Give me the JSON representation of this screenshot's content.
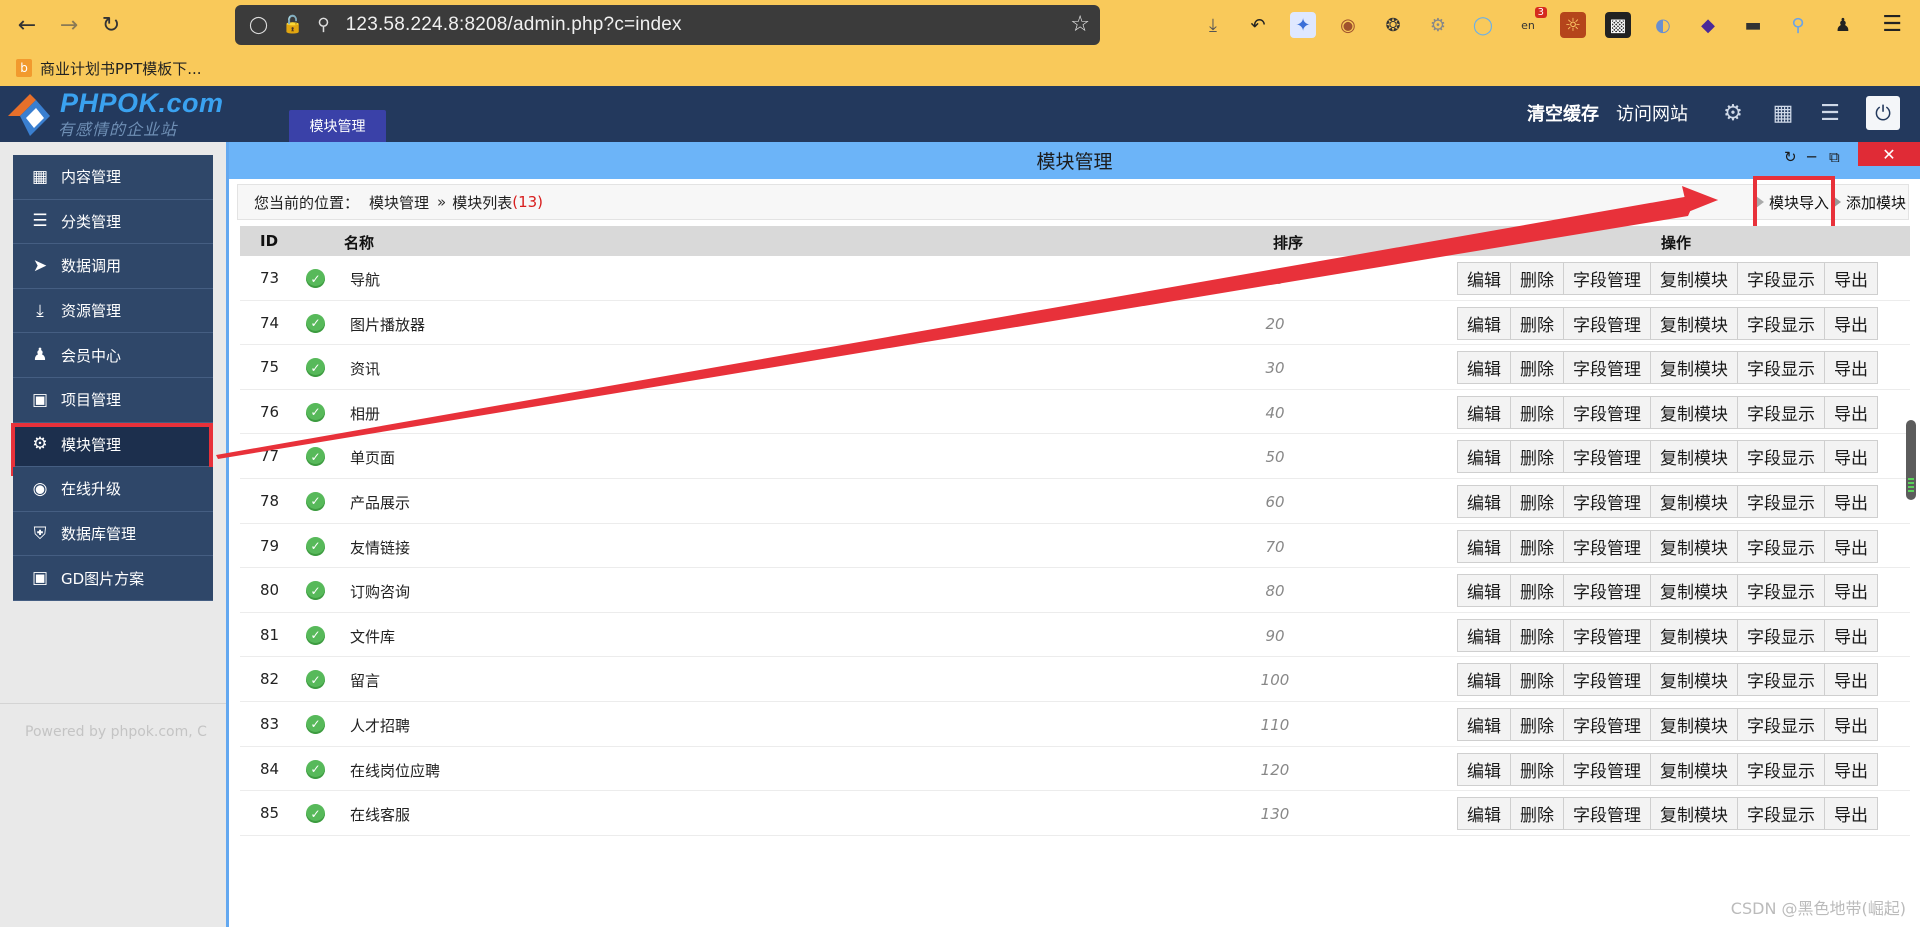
{
  "browser": {
    "url": "123.58.224.8:8208/admin.php?c=index",
    "bookmark": "商业计划书PPT模板下...",
    "ext_badge": "3",
    "ext_sub": "en"
  },
  "header": {
    "logo_text": "PHPOK.com",
    "logo_slogan": "有感情的企业站",
    "active_tab": "模块管理",
    "clear_cache": "清空缓存",
    "visit_site": "访问网站"
  },
  "sidebar": {
    "items": [
      {
        "label": "内容管理",
        "icon": "building-icon"
      },
      {
        "label": "分类管理",
        "icon": "layers-icon"
      },
      {
        "label": "数据调用",
        "icon": "rocket-icon"
      },
      {
        "label": "资源管理",
        "icon": "download-icon"
      },
      {
        "label": "会员中心",
        "icon": "user-icon"
      },
      {
        "label": "项目管理",
        "icon": "projector-icon"
      },
      {
        "label": "模块管理",
        "icon": "sliders-icon",
        "active": true
      },
      {
        "label": "在线升级",
        "icon": "globe-icon"
      },
      {
        "label": "数据库管理",
        "icon": "shield-icon"
      },
      {
        "label": "GD图片方案",
        "icon": "image-icon"
      }
    ],
    "footer": "Powered by phpok.com, C"
  },
  "window": {
    "title": "模块管理",
    "breadcrumb_label": "您当前的位置：",
    "breadcrumb_root": "模块管理",
    "breadcrumb_sep": "»",
    "breadcrumb_current": "模块列表",
    "breadcrumb_count": "(13)",
    "import_button": "模块导入",
    "add_button": "添加模块"
  },
  "table": {
    "headers": {
      "id": "ID",
      "name": "名称",
      "sort": "排序",
      "ops": "操作"
    },
    "op_labels": [
      "编辑",
      "删除",
      "字段管理",
      "复制模块",
      "字段显示",
      "导出"
    ],
    "rows": [
      {
        "id": "73",
        "name": "导航",
        "sort": "10"
      },
      {
        "id": "74",
        "name": "图片播放器",
        "sort": "20"
      },
      {
        "id": "75",
        "name": "资讯",
        "sort": "30"
      },
      {
        "id": "76",
        "name": "相册",
        "sort": "40"
      },
      {
        "id": "77",
        "name": "单页面",
        "sort": "50"
      },
      {
        "id": "78",
        "name": "产品展示",
        "sort": "60"
      },
      {
        "id": "79",
        "name": "友情链接",
        "sort": "70"
      },
      {
        "id": "80",
        "name": "订购咨询",
        "sort": "80"
      },
      {
        "id": "81",
        "name": "文件库",
        "sort": "90"
      },
      {
        "id": "82",
        "name": "留言",
        "sort": "100"
      },
      {
        "id": "83",
        "name": "人才招聘",
        "sort": "110"
      },
      {
        "id": "84",
        "name": "在线岗位应聘",
        "sort": "120"
      },
      {
        "id": "85",
        "name": "在线客服",
        "sort": "130"
      }
    ]
  },
  "watermark": "CSDN @黑色地带(崛起)",
  "colors": {
    "header_bg": "#23395d",
    "sidebar_bg": "#2f4769",
    "window_title_bg": "#6cb4f8",
    "annotation_red": "#e8313a",
    "browser_bar": "#f9c95a"
  }
}
